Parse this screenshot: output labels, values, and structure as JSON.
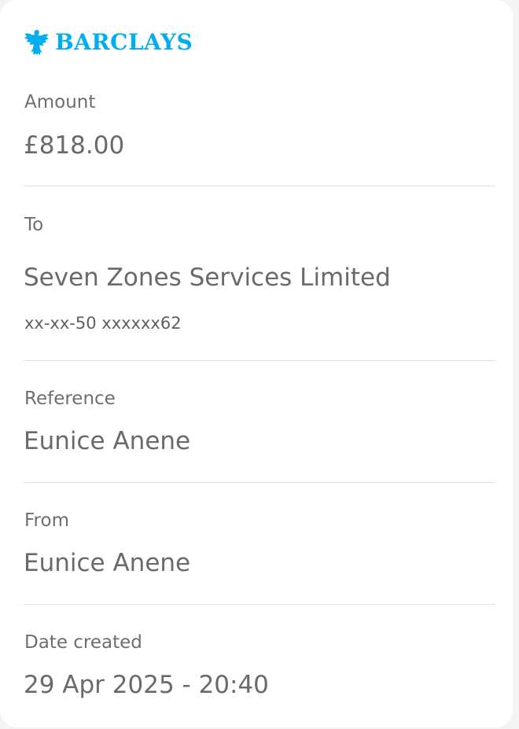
{
  "brand": {
    "name": "BARCLAYS",
    "icon": "eagle-icon",
    "color": "#00aeef"
  },
  "amount": {
    "label": "Amount",
    "value": "£818.00"
  },
  "to": {
    "label": "To",
    "name": "Seven Zones Services Limited",
    "account": "xx-xx-50 xxxxxx62"
  },
  "reference": {
    "label": "Reference",
    "value": "Eunice Anene"
  },
  "from": {
    "label": "From",
    "value": "Eunice Anene"
  },
  "date_created": {
    "label": "Date created",
    "value": "29 Apr 2025 - 20:40"
  }
}
